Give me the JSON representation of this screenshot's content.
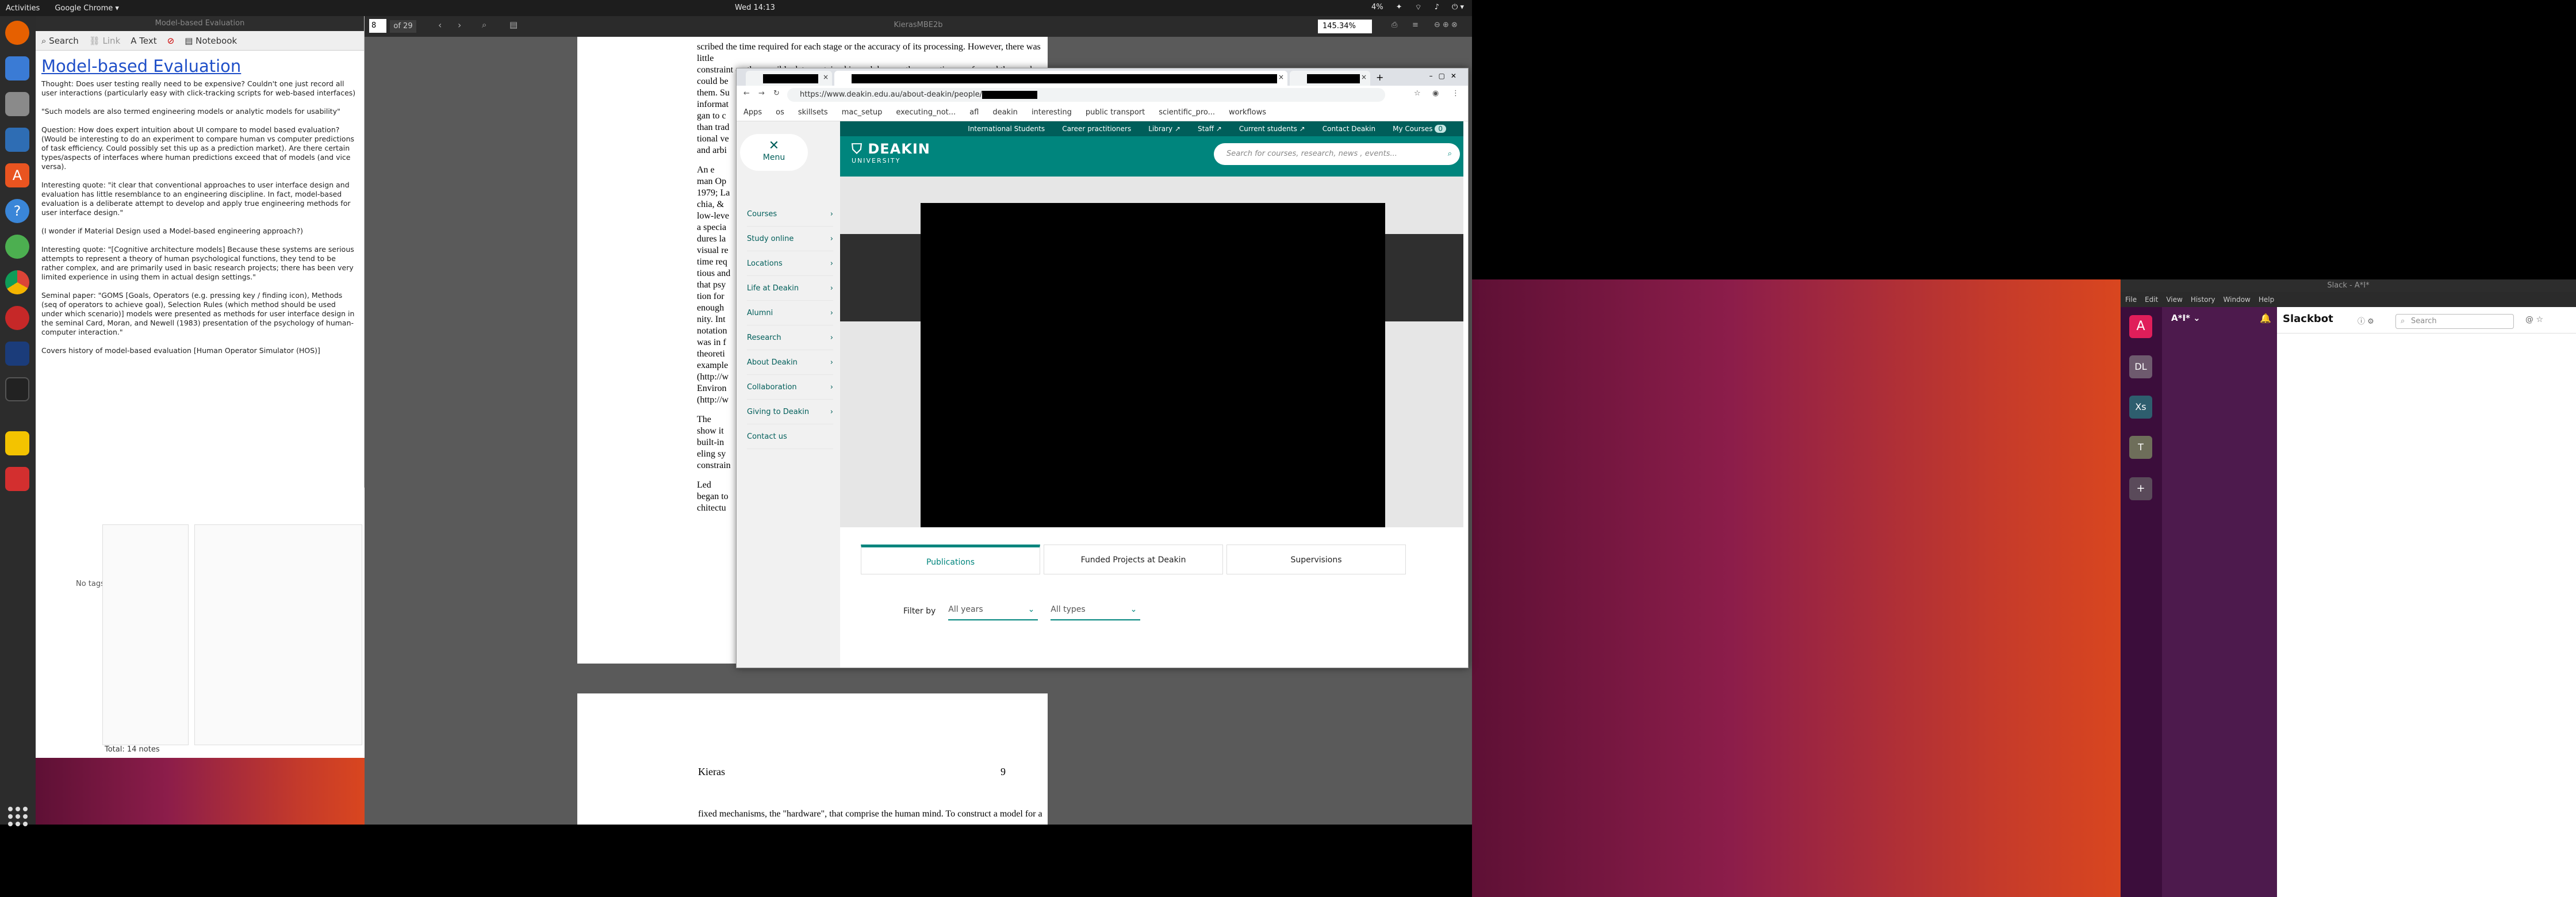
{
  "topbar": {
    "activities": "Activities",
    "app": "Google Chrome ▾",
    "clock": "Wed 14:13",
    "battery": "4%",
    "tray_icons": [
      "dropbox-icon",
      "network-icon",
      "volume-icon",
      "power-icon"
    ]
  },
  "notes": {
    "window_title": "Model-based Evaluation",
    "toolbar": {
      "search": "Search",
      "link": "Link",
      "text": "Text",
      "notebook": "Notebook"
    },
    "heading": "Model-based Evaluation",
    "paragraphs": [
      "Thought: Does user testing really need to be expensive? Couldn't one just record all user interactions (particularly easy with click-tracking scripts for web-based interfaces)",
      "\"Such models are also termed engineering models or analytic models for usability\"",
      "Question: How does expert intuition about UI compare to model based evaluation? (Would be interesting to do an experiment to compare human vs computer predictions of task efficiency. Could possibly set this up as a prediction market). Are there certain types/aspects of interfaces where human predictions exceed that of models (and vice versa).",
      "Interesting quote: \"it clear that conventional approaches to user interface design and evaluation has little resemblance to an engineering discipline. In fact, model-based evaluation is a deliberate attempt to develop and apply true engineering methods for user interface design.\"",
      "(I wonder if Material Design used a Model-based engineering approach?)",
      "Interesting quote: \"[Cognitive architecture models] Because these systems are serious attempts to represent a theory of human psychological functions, they tend to be rather complex, and are primarily used in basic research projects; there has been very limited experience in using them in actual design settings.\"",
      "Seminal paper: \"GOMS [Goals, Operators (e.g. pressing key / finding icon), Methods (seq of operators to achieve goal), Selection Rules (which method should be used under which scenario)] models were presented as methods for user interface design in the seminal Card, Moran, and Newell (1983) presentation of the psychology of human-computer interaction.\"",
      "Covers history of model-based evaluation [Human Operator Simulator (HOS)]"
    ],
    "no_tags": "No tags",
    "total": "Total: 14 notes"
  },
  "evince": {
    "page_input": "8",
    "page_of": "of 29",
    "doc_title": "KierasMBE2b",
    "zoom": "145.34%",
    "page1_lines": [
      "scribed the time required for each stage or the accuracy of its processing. However, there was little",
      "constraint on the possible data contained in each box, or the operations performed there; a box",
      "could be",
      "them. Su",
      "informat",
      "gan to c",
      "than trad",
      "tional ve",
      "and arbi",
      "An e",
      "man Op",
      "1979; La",
      "chia, &",
      "low-leve",
      "a specia",
      "dures la",
      "visual re",
      "time req",
      "tious and",
      "that psy",
      "tion for",
      "enough",
      "nity. Int",
      "notation",
      "was in f",
      "theoreti",
      "example",
      "(http://w",
      "Environ",
      "(http://w",
      "The",
      "show it",
      "built-in",
      "eling sy",
      "constrain",
      "Led",
      "began to",
      "chitectu"
    ],
    "page2_header": "Kieras",
    "page2_number": "9",
    "page2_line": "fixed mechanisms, the \"hardware\", that comprise the human mind. To construct a model for a"
  },
  "chrome": {
    "new_tab": "+",
    "url": "https://www.deakin.edu.au/about-deakin/people/",
    "bookmarks": [
      "Apps",
      "os",
      "skillsets",
      "mac_setup",
      "executing_not...",
      "afl",
      "deakin",
      "interesting",
      "public transport",
      "scientific_pro...",
      "workflows"
    ],
    "site": {
      "menu_label": "Menu",
      "menu_items": [
        "Courses",
        "Study online",
        "Locations",
        "Life at Deakin",
        "Alumni",
        "Research",
        "About Deakin",
        "Collaboration",
        "Giving to Deakin",
        "Contact us"
      ],
      "utility_links": [
        "International Students",
        "Career practitioners",
        "Library ↗",
        "Staff ↗",
        "Current students ↗",
        "Contact Deakin",
        "My Courses"
      ],
      "my_courses_count": "0",
      "logo": "DEAKIN",
      "logo_sub": "UNIVERSITY",
      "search_placeholder": "Search for courses, research, news , events...",
      "profile_tabs": [
        "Publications",
        "Funded Projects at Deakin",
        "Supervisions"
      ],
      "filter_label": "Filter by",
      "filter_years": "All years",
      "filter_types": "All types"
    }
  },
  "slack": {
    "title": "Slack - A*I*",
    "menu": [
      "File",
      "Edit",
      "View",
      "History",
      "Window",
      "Help"
    ],
    "workspace": "A*I* ⌄",
    "teams": [
      "A",
      "DL",
      "Xs",
      "T"
    ],
    "team_labels": [
      "",
      "",
      "",
      ""
    ],
    "channel": "Slackbot",
    "search_placeholder": "Search"
  }
}
